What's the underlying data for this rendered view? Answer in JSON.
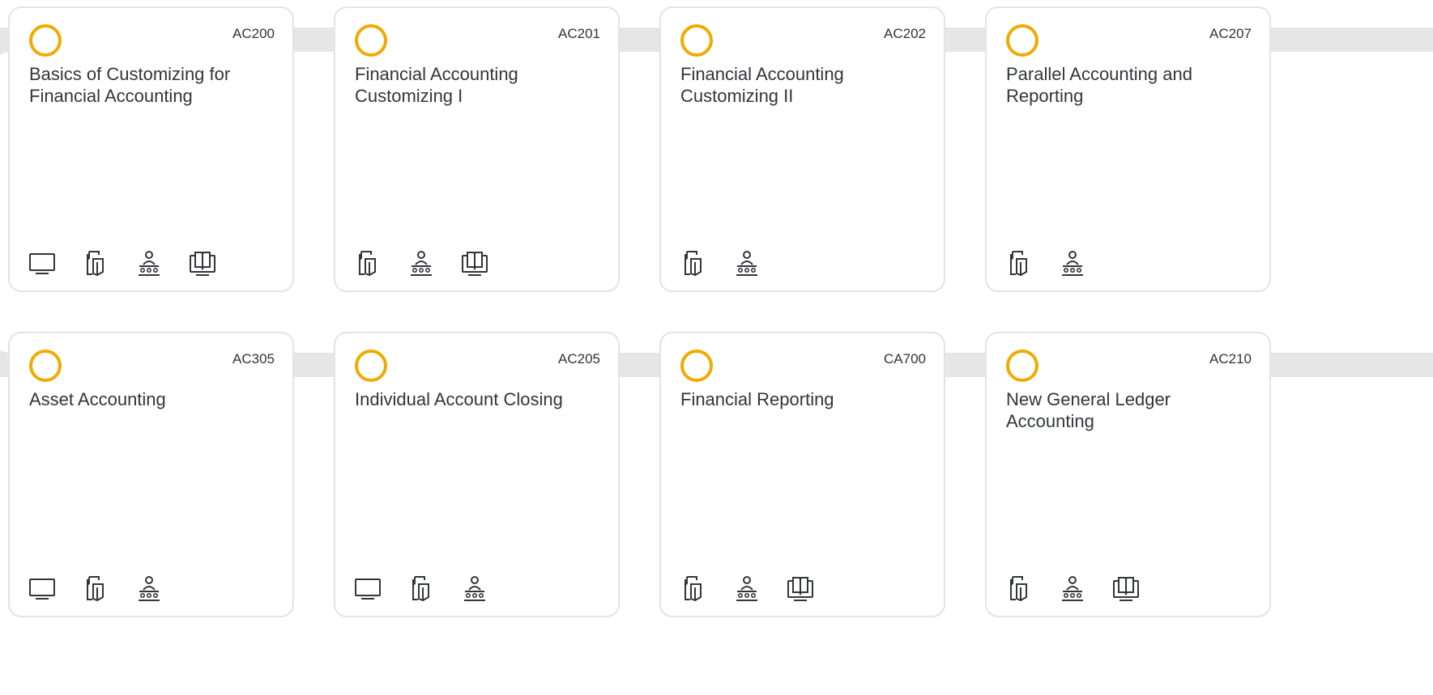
{
  "courses": [
    {
      "code": "AC200",
      "title": "Basics of Customizing for Financial Accounting",
      "formats": [
        "monitor-icon",
        "documents-icon",
        "classroom-icon",
        "ebook-icon"
      ]
    },
    {
      "code": "AC201",
      "title": "Financial Accounting Customizing I",
      "formats": [
        "documents-icon",
        "classroom-icon",
        "ebook-icon"
      ]
    },
    {
      "code": "AC202",
      "title": "Financial Accounting Customizing II",
      "formats": [
        "documents-icon",
        "classroom-icon"
      ]
    },
    {
      "code": "AC207",
      "title": "Parallel Accounting and Reporting",
      "formats": [
        "documents-icon",
        "classroom-icon"
      ]
    },
    {
      "code": "AC305",
      "title": "Asset Accounting",
      "formats": [
        "monitor-icon",
        "documents-icon",
        "classroom-icon"
      ]
    },
    {
      "code": "AC205",
      "title": "Individual Account Closing",
      "formats": [
        "monitor-icon",
        "documents-icon",
        "classroom-icon"
      ]
    },
    {
      "code": "CA700",
      "title": "Financial Reporting",
      "formats": [
        "documents-icon",
        "classroom-icon",
        "ebook-icon"
      ]
    },
    {
      "code": "AC210",
      "title": "New General Ledger Accounting",
      "formats": [
        "documents-icon",
        "classroom-icon",
        "ebook-icon"
      ]
    }
  ],
  "colors": {
    "accent_ring": "#f0ab00",
    "track": "#e6e6e6",
    "card_border": "#e4e4e4",
    "text": "#32363a"
  }
}
